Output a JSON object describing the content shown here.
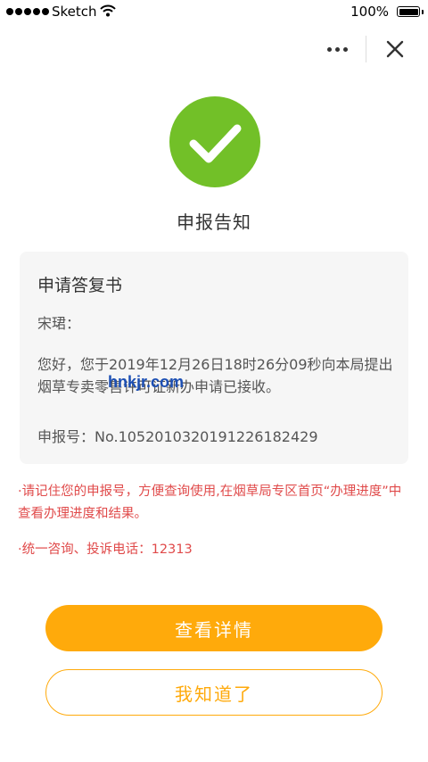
{
  "status_bar": {
    "carrier": "Sketch",
    "battery_percent": "100%",
    "battery_level": 1.0
  },
  "nav": {
    "more_icon": "more-dots-icon",
    "close_icon": "close-icon"
  },
  "result": {
    "icon": "check-circle-icon",
    "icon_color": "#72c028",
    "title": "申报告知"
  },
  "card": {
    "title": "申请答复书",
    "greeting": "宋珺：",
    "body": "您好，您于2019年12月26日18时26分09秒向本局提出 烟草专卖零售许可证新办申请已接收。",
    "application_number": "申报号：No.1052010320191226182429"
  },
  "notices": [
    "·请记住您的申报号，方便查询使用,在烟草局专区首页“办理进度”中查看办理进度和结果。",
    "·统一咨询、投诉电话：12313"
  ],
  "buttons": {
    "view_details": "查看详情",
    "got_it": "我知道了"
  },
  "watermark": "hnkjr.com",
  "colors": {
    "accent": "#ffaa0b",
    "success": "#72c028",
    "notice": "#e04a4a"
  }
}
